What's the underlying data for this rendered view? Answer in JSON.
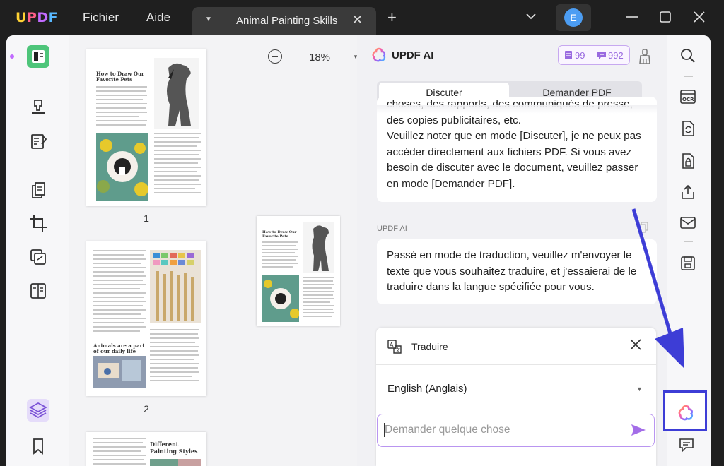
{
  "app": {
    "logo": "UPDF",
    "menu": [
      "Fichier",
      "Aide"
    ],
    "tab_title": "Animal Painting Skills",
    "avatar_letter": "E"
  },
  "thumbnails": {
    "page1_title": "How to Draw Our Favorite Pets",
    "page1_number": "1",
    "page2_heading": "Animals are a part of our daily life",
    "page2_number": "2",
    "page3_title": "Different Painting Styles"
  },
  "viewer": {
    "zoom": "18%"
  },
  "ai_panel": {
    "title": "UPDF AI",
    "credits_doc": "99",
    "credits_chat": "992",
    "tabs": [
      "Discuter",
      "Demander PDF"
    ],
    "active_tab": "Discuter",
    "message1": "choses, des rapports, des communiqués de presse, des copies publicitaires, etc.\nVeuillez noter que en mode [Discuter], je ne peux pas accéder directement aux fichiers PDF. Si vous avez besoin de discuter avec le document, veuillez passer en mode [Demander PDF].",
    "sender_label": "UPDF AI",
    "message2": "Passé en mode de traduction, veuillez m'envoyer le texte que vous souhaitez traduire, et j'essaierai de le traduire dans la langue spécifiée pour vous.",
    "translate": {
      "title": "Traduire",
      "language": "English (Anglais)",
      "input_placeholder": "Demander quelque chose"
    }
  },
  "colors": {
    "accent_purple": "#9a6ae0",
    "highlight_blue": "#3d3dd6",
    "titlebar": "#1f1f1f"
  }
}
